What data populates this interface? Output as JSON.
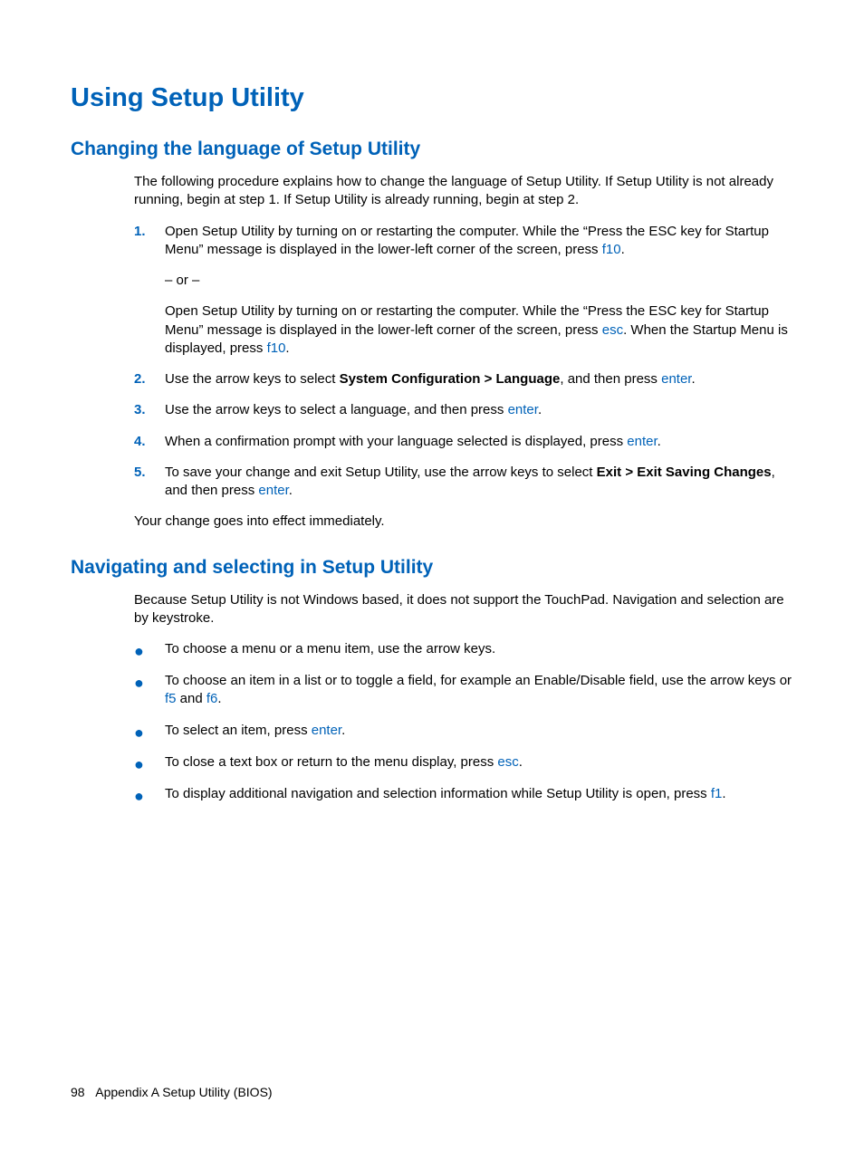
{
  "h1": "Using Setup Utility",
  "sec1": {
    "h2": "Changing the language of Setup Utility",
    "intro": "The following procedure explains how to change the language of Setup Utility. If Setup Utility is not already running, begin at step 1. If Setup Utility is already running, begin at step 2.",
    "steps": {
      "n1": "1.",
      "s1a": "Open Setup Utility by turning on or restarting the computer. While the “Press the ESC key for Startup Menu” message is displayed in the lower-left corner of the screen, press ",
      "s1b": "f10",
      "s1c": ".",
      "or": "– or –",
      "s1d": "Open Setup Utility by turning on or restarting the computer. While the “Press the ESC key for Startup Menu” message is displayed in the lower-left corner of the screen, press ",
      "s1e": "esc",
      "s1f": ". When the Startup Menu is displayed, press ",
      "s1g": "f10",
      "s1h": ".",
      "n2": "2.",
      "s2a": "Use the arrow keys to select ",
      "s2b": "System Configuration > Language",
      "s2c": ", and then press ",
      "s2d": "enter",
      "s2e": ".",
      "n3": "3.",
      "s3a": "Use the arrow keys to select a language, and then press ",
      "s3b": "enter",
      "s3c": ".",
      "n4": "4.",
      "s4a": "When a confirmation prompt with your language selected is displayed, press ",
      "s4b": "enter",
      "s4c": ".",
      "n5": "5.",
      "s5a": "To save your change and exit Setup Utility, use the arrow keys to select ",
      "s5b": "Exit > Exit Saving Changes",
      "s5c": ", and then press ",
      "s5d": "enter",
      "s5e": "."
    },
    "outro": "Your change goes into effect immediately."
  },
  "sec2": {
    "h2": "Navigating and selecting in Setup Utility",
    "intro": "Because Setup Utility is not Windows based, it does not support the TouchPad. Navigation and selection are by keystroke.",
    "b1": "To choose a menu or a menu item, use the arrow keys.",
    "b2a": "To choose an item in a list or to toggle a field, for example an Enable/Disable field, use the arrow keys or ",
    "b2b": "f5",
    "b2c": " and ",
    "b2d": "f6",
    "b2e": ".",
    "b3a": "To select an item, press ",
    "b3b": "enter",
    "b3c": ".",
    "b4a": "To close a text box or return to the menu display, press ",
    "b4b": "esc",
    "b4c": ".",
    "b5a": "To display additional navigation and selection information while Setup Utility is open, press ",
    "b5b": "f1",
    "b5c": "."
  },
  "footer": {
    "pageno": "98",
    "appendix": "Appendix A   Setup Utility (BIOS)"
  }
}
